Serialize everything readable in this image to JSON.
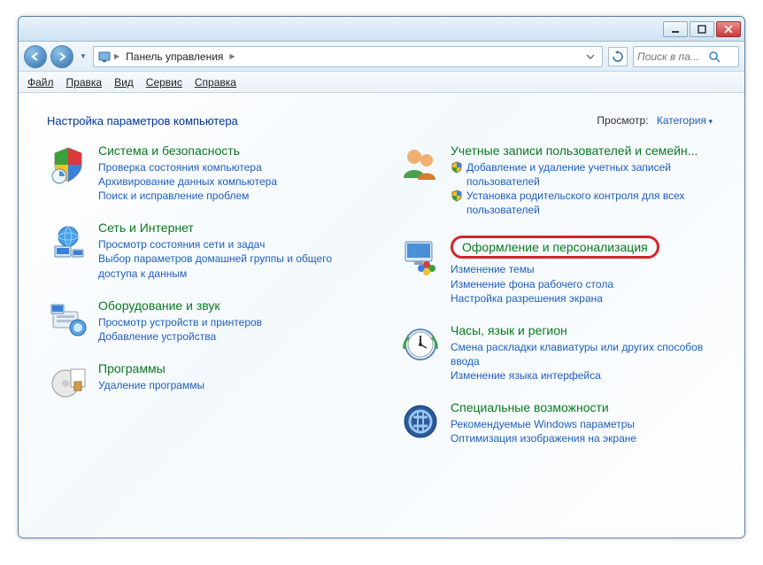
{
  "breadcrumb": {
    "root": "Панель управления"
  },
  "search": {
    "placeholder": "Поиск в па..."
  },
  "menu": {
    "file": "Файл",
    "edit": "Правка",
    "view": "Вид",
    "tools": "Сервис",
    "help": "Справка"
  },
  "heading": "Настройка параметров компьютера",
  "viewLabel": "Просмотр:",
  "viewValue": "Категория",
  "left": [
    {
      "title": "Система и безопасность",
      "links": [
        "Проверка состояния компьютера",
        "Архивирование данных компьютера",
        "Поиск и исправление проблем"
      ]
    },
    {
      "title": "Сеть и Интернет",
      "links": [
        "Просмотр состояния сети и задач",
        "Выбор параметров домашней группы и общего доступа к данным"
      ]
    },
    {
      "title": "Оборудование и звук",
      "links": [
        "Просмотр устройств и принтеров",
        "Добавление устройства"
      ]
    },
    {
      "title": "Программы",
      "links": [
        "Удаление программы"
      ]
    }
  ],
  "right": [
    {
      "title": "Учетные записи пользователей и семейн...",
      "shieldLinks": [
        "Добавление и удаление учетных записей пользователей",
        "Установка родительского контроля для всех пользователей"
      ]
    },
    {
      "title": "Оформление и персонализация",
      "highlighted": true,
      "links": [
        "Изменение темы",
        "Изменение фона рабочего стола",
        "Настройка разрешения экрана"
      ]
    },
    {
      "title": "Часы, язык и регион",
      "links": [
        "Смена раскладки клавиатуры или других способов ввода",
        "Изменение языка интерфейса"
      ]
    },
    {
      "title": "Специальные возможности",
      "links": [
        "Рекомендуемые Windows параметры",
        "Оптимизация изображения на экране"
      ]
    }
  ]
}
